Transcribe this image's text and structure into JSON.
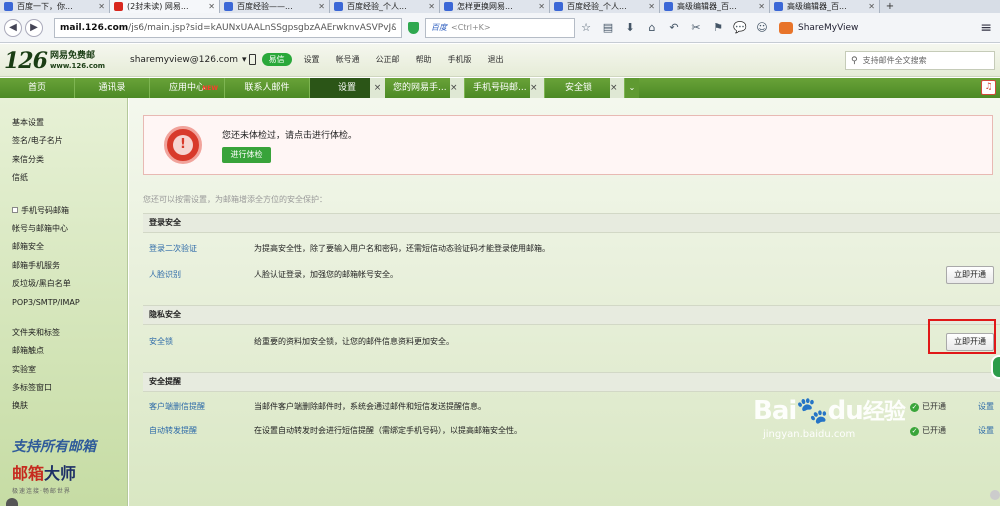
{
  "browser": {
    "tabs": [
      {
        "label": "百度一下，你...",
        "color": "#3b67d6",
        "active": false
      },
      {
        "label": "(2封未读) 网易...",
        "color": "#d8271e",
        "active": true
      },
      {
        "label": "百度经验——...",
        "color": "#3b67d6",
        "active": false
      },
      {
        "label": "百度经验_个人...",
        "color": "#3b67d6",
        "active": false
      },
      {
        "label": "怎样更换网易...",
        "color": "#3b67d6",
        "active": false
      },
      {
        "label": "百度经验_个人...",
        "color": "#3b67d6",
        "active": false
      },
      {
        "label": "高级编辑器_百...",
        "color": "#3b67d6",
        "active": false
      },
      {
        "label": "高级编辑器_百...",
        "color": "#3b67d6",
        "active": false
      }
    ],
    "new_tab": "+",
    "url_host": "mail.126.com",
    "url_rest": "/js6/main.jsp?sid=kAUNxUAALnSSgpsgbzAAErwknvASVPvJ&df",
    "search_engine": "百度",
    "search_placeholder": "<Ctrl+K>",
    "profile_name": "ShareMyView",
    "menu_icon": "≡"
  },
  "mail": {
    "logo_num": "126",
    "logo_name": "网易免费邮",
    "logo_url": "www.126.com",
    "account": "sharemyview@126.com",
    "account_arrow": "▾",
    "yixin": "易信",
    "links": [
      "设置",
      "帐号通",
      "公正邮",
      "帮助",
      "手机版",
      "退出"
    ],
    "search_placeholder": "支持邮件全文搜索"
  },
  "main_tabs": [
    {
      "label": "首页"
    },
    {
      "label": "通讯录"
    },
    {
      "label": "应用中心",
      "badge": "NEW"
    },
    {
      "label": "联系人邮件"
    },
    {
      "label": "设置",
      "active": true
    },
    {
      "label": "您的网易手..."
    },
    {
      "label": "手机号码邮..."
    },
    {
      "label": "安全锁"
    }
  ],
  "tab_close": "×",
  "sidebar": {
    "group1": [
      "基本设置",
      "签名/电子名片",
      "来信分类",
      "信纸"
    ],
    "group2": [
      "手机号码邮箱",
      "帐号与邮箱中心",
      "邮箱安全",
      "邮箱手机服务",
      "反垃圾/黑白名单",
      "POP3/SMTP/IMAP"
    ],
    "group3": [
      "文件夹和标签",
      "邮箱触点",
      "实验室",
      "多标签窗口",
      "换肤"
    ],
    "promo_line1": "支持所有邮箱",
    "promo_line2a": "邮箱",
    "promo_line2b": "大师",
    "promo_line3": "极速连接·畅邮世界"
  },
  "content": {
    "checkup_message": "您还未体检过，请点击进行体检。",
    "checkup_button": "进行体检",
    "hint": "您还可以按需设置，为邮箱增添全方位的安全保护：",
    "sections": {
      "login": {
        "title": "登录安全",
        "rows": [
          {
            "name": "登录二次验证",
            "desc": "为提高安全性，除了要输入用户名和密码，还需短信动态验证码才能登录使用邮箱。"
          },
          {
            "name": "人脸识别",
            "desc": "人脸认证登录，加强您的邮箱帐号安全。",
            "button": "立即开通"
          }
        ]
      },
      "privacy": {
        "title": "隐私安全",
        "rows": [
          {
            "name": "安全锁",
            "desc": "给重要的资料加安全锁，让您的邮件信息资料更加安全。",
            "button": "立即开通"
          }
        ]
      },
      "alert": {
        "title": "安全提醒",
        "rows": [
          {
            "name": "客户端删信提醒",
            "desc": "当邮件客户端删除邮件时，系统会通过邮件和短信发送提醒信息。",
            "status": "已开通",
            "settings": "设置"
          },
          {
            "name": "自动转发提醒",
            "desc": "在设置自动转发时会进行短信提醒（需绑定手机号码），以提高邮箱安全性。",
            "status": "已开通",
            "settings": "设置"
          }
        ]
      }
    }
  },
  "watermark": {
    "brand": "Bai",
    "brand_cn": "经验",
    "brand_end": "du",
    "url": "jingyan.baidu.com"
  },
  "colors": {
    "tab_green": "#4c8a25",
    "active_tab": "#2b5517",
    "link_blue": "#2d6aa8",
    "checkup_red": "#d83a2b",
    "highlight_red": "#e01818"
  }
}
